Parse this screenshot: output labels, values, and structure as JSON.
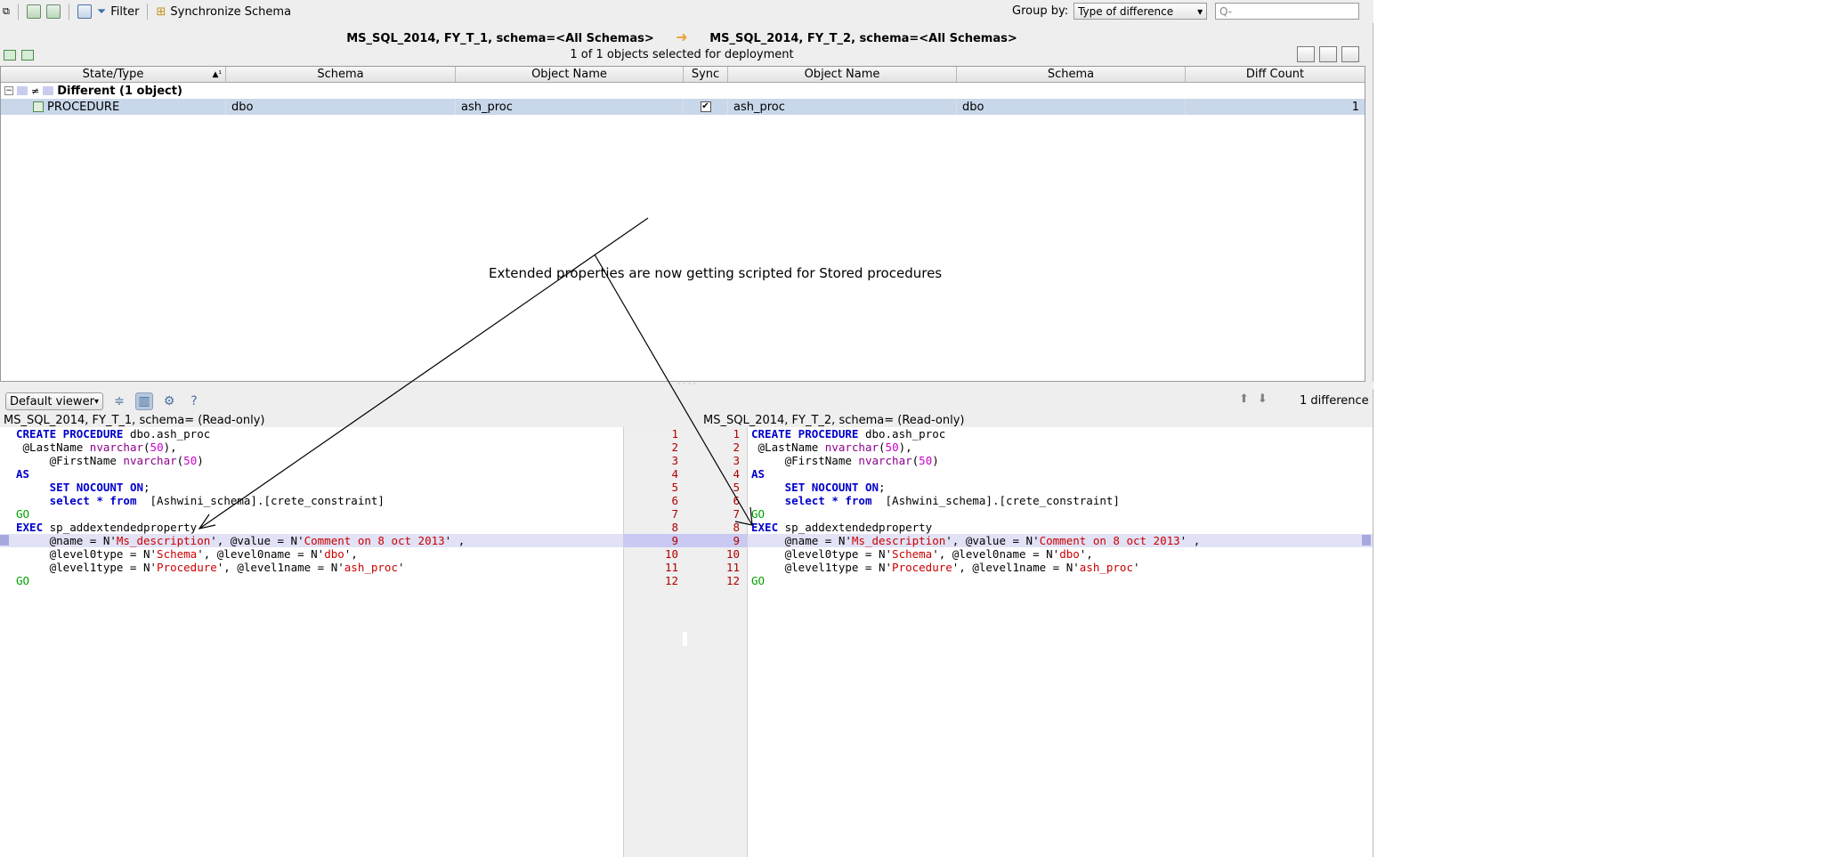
{
  "toolbar": {
    "filter_label": "Filter",
    "sync_label": "Synchronize Schema",
    "group_by_label": "Group by:",
    "group_by_value": "Type of difference",
    "search_placeholder": "Q-"
  },
  "comparison": {
    "left": "MS_SQL_2014, FY_T_1,  schema=<All Schemas>",
    "right": "MS_SQL_2014, FY_T_2,  schema=<All Schemas>",
    "selection_info": "1 of 1 objects selected for deployment"
  },
  "grid": {
    "columns": [
      "State/Type",
      "Schema",
      "Object Name",
      "Sync",
      "Object Name",
      "Schema",
      "Diff Count"
    ],
    "sort_indicator": "▲¹",
    "group_label": "Different (1 object)",
    "rows": [
      {
        "type": "PROCEDURE",
        "schema_l": "dbo",
        "name_l": "ash_proc",
        "sync": "✔",
        "name_r": "ash_proc",
        "schema_r": "dbo",
        "diff_count": "1"
      }
    ]
  },
  "annotation": "Extended properties are now getting scripted for Stored procedures",
  "viewer": {
    "mode": "Default viewer",
    "help": "?",
    "diff_summary": "1 difference",
    "left_title": "MS_SQL_2014, FY_T_1, schema= (Read-only)",
    "right_title": "MS_SQL_2014, FY_T_2, schema= (Read-only)"
  },
  "line_numbers": {
    "left": [
      "1",
      "2",
      "3",
      "4",
      "5",
      "6",
      "7",
      "8",
      "9",
      "10",
      "11",
      "12"
    ],
    "right": [
      "1",
      "2",
      "3",
      "4",
      "5",
      "6",
      "7",
      "8",
      "9",
      "10",
      "11",
      "12"
    ]
  },
  "code": {
    "l1_kw": "CREATE PROCEDURE",
    "l1_rest": " dbo.ash_proc",
    "l2_a": " @LastName ",
    "l2_ty": "nvarchar",
    "l2_b": "(",
    "l2_num": "50",
    "l2_c": "),",
    "l3_a": "     @FirstName ",
    "l3_ty": "nvarchar",
    "l3_b": "(",
    "l3_num": "50",
    "l3_c": ")",
    "l4_kw": "AS",
    "l5_a": "     ",
    "l5_kw": "SET NOCOUNT ON",
    "l5_b": ";",
    "l6_a": "     ",
    "l6_kw": "select * from",
    "l6_b": "  [Ashwini_schema].[crete_constraint]",
    "l7": "GO",
    "l8_kw": "EXEC",
    "l8_rest": " sp_addextendedproperty",
    "l9_a": "     @name = N'",
    "l9_s1": "Ms_description",
    "l9_b": "', @value = N'",
    "l9_s2": "Comment on 8 oct 2013",
    "l9_c": "' ,",
    "l10_a": "     @level0type = N'",
    "l10_s1": "Schema",
    "l10_b": "', @level0name = N'",
    "l10_s2": "dbo",
    "l10_c": "',",
    "l11_a": "     @level1type = N'",
    "l11_s1": "Procedure",
    "l11_b": "', @level1name = N'",
    "l11_s2": "ash_proc",
    "l11_c": "'",
    "l12": "GO"
  }
}
